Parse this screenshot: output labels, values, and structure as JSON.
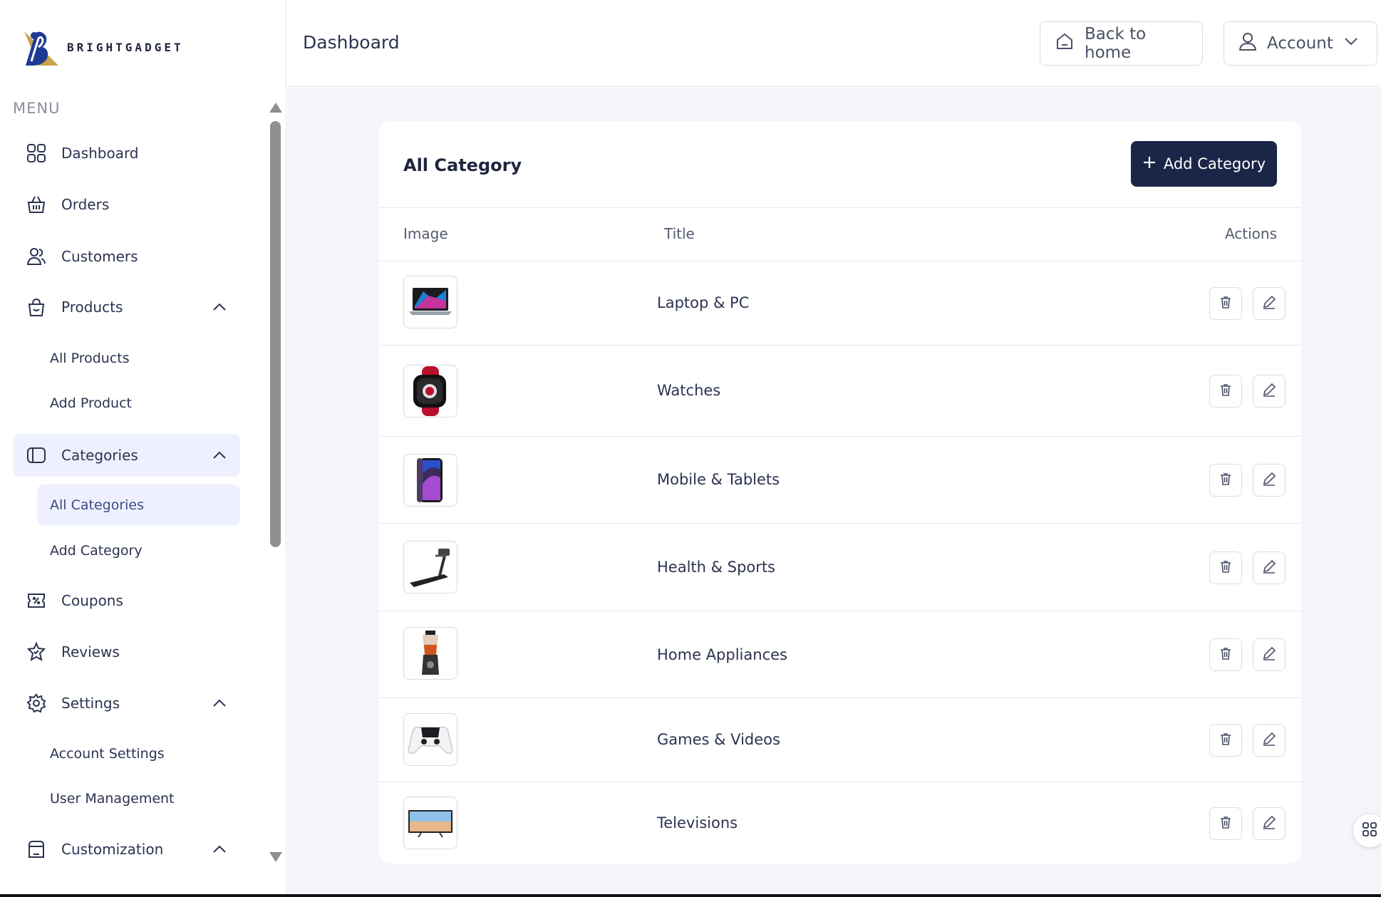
{
  "brand": {
    "name": "BRIGHTGADGET"
  },
  "sidebar": {
    "menu_heading": "MENU",
    "items": [
      {
        "label": "Dashboard",
        "icon": "grid-icon"
      },
      {
        "label": "Orders",
        "icon": "basket-icon"
      },
      {
        "label": "Customers",
        "icon": "users-icon"
      },
      {
        "label": "Products",
        "icon": "bag-icon",
        "expanded": true
      },
      {
        "label": "Categories",
        "icon": "tag-icon",
        "expanded": true,
        "active": true
      },
      {
        "label": "Coupons",
        "icon": "coupon-icon"
      },
      {
        "label": "Reviews",
        "icon": "star-badge-icon"
      },
      {
        "label": "Settings",
        "icon": "gear-icon",
        "expanded": true
      },
      {
        "label": "Customization",
        "icon": "store-icon",
        "expanded": true
      }
    ],
    "products_sub": [
      "All Products",
      "Add Product"
    ],
    "categories_sub": [
      "All Categories",
      "Add Category"
    ],
    "settings_sub": [
      "Account Settings",
      "User Management"
    ]
  },
  "header": {
    "title": "Dashboard",
    "back_home": "Back to home",
    "account": "Account"
  },
  "card": {
    "title": "All Category",
    "add_button": "Add Category",
    "columns": {
      "image": "Image",
      "title": "Title",
      "actions": "Actions"
    },
    "rows": [
      {
        "title": "Laptop & PC",
        "image": "laptop"
      },
      {
        "title": "Watches",
        "image": "watch"
      },
      {
        "title": "Mobile & Tablets",
        "image": "phone"
      },
      {
        "title": "Health & Sports",
        "image": "treadmill"
      },
      {
        "title": "Home Appliances",
        "image": "blender"
      },
      {
        "title": "Games & Videos",
        "image": "controller"
      },
      {
        "title": "Televisions",
        "image": "tv"
      }
    ]
  },
  "colors": {
    "accent": "#1a2548",
    "active_bg": "#eef0fd",
    "page_bg": "#f3f5fb"
  }
}
